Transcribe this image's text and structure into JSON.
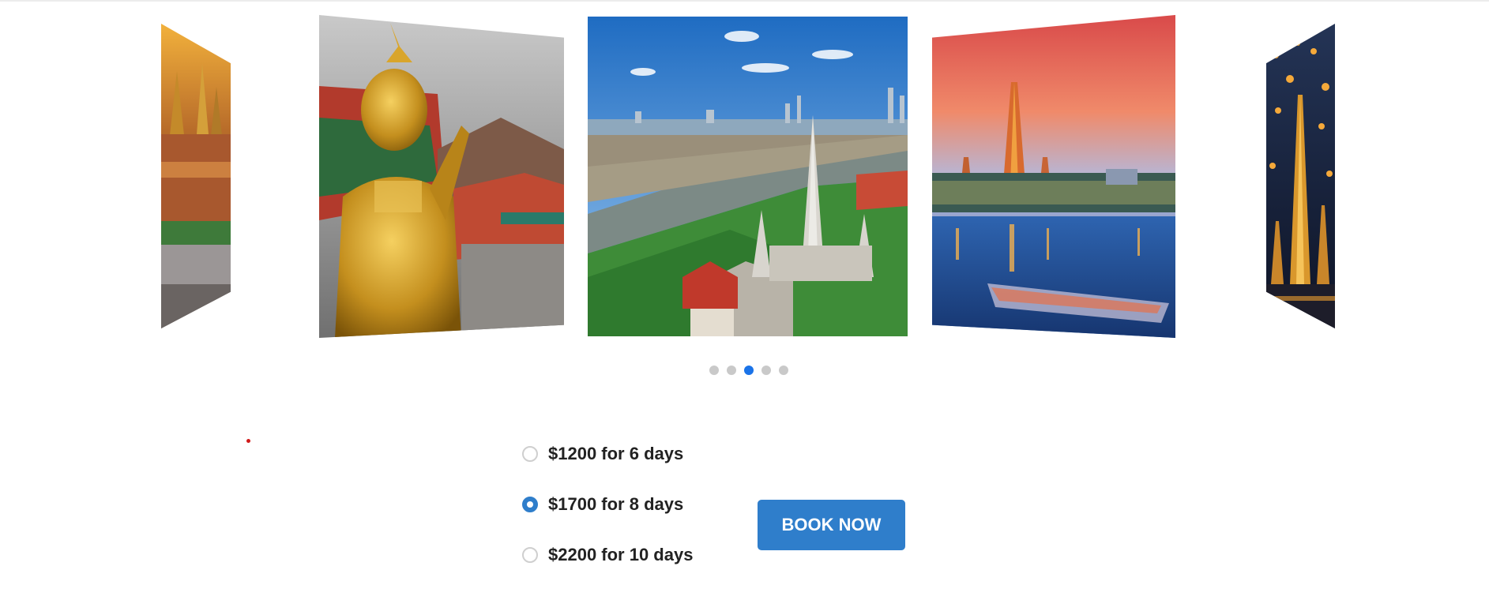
{
  "carousel": {
    "slides": [
      {
        "icon": "grand-palace-photo"
      },
      {
        "icon": "golden-statue-photo"
      },
      {
        "icon": "wat-arun-aerial-photo"
      },
      {
        "icon": "sunset-temple-river-photo"
      },
      {
        "icon": "lantern-temple-photo"
      }
    ],
    "active_index": 2,
    "dot_count": 5
  },
  "booking": {
    "options": [
      {
        "label": "$1200 for 6 days",
        "selected": false
      },
      {
        "label": "$1700 for 8 days",
        "selected": true
      },
      {
        "label": "$2200 for 10 days",
        "selected": false
      }
    ],
    "book_button": "BOOK NOW"
  },
  "colors": {
    "accent": "#2f7ecb",
    "dot_active": "#1a73e8",
    "dot_inactive": "#c9c9c9"
  }
}
